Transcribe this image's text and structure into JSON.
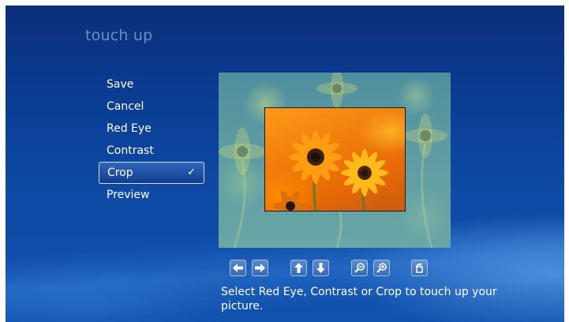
{
  "page": {
    "title": "touch up",
    "hint": "Select Red Eye, Contrast or Crop to touch up your picture."
  },
  "menu": {
    "items": [
      {
        "label": "Save",
        "active": false
      },
      {
        "label": "Cancel",
        "active": false
      },
      {
        "label": "Red Eye",
        "active": false
      },
      {
        "label": "Contrast",
        "active": false
      },
      {
        "label": "Crop",
        "active": true,
        "check": "✓"
      },
      {
        "label": "Preview",
        "active": false
      }
    ]
  },
  "toolbar": {
    "buttons": [
      {
        "name": "pan-left-button",
        "icon": "arrow-left-icon"
      },
      {
        "name": "pan-right-button",
        "icon": "arrow-right-icon"
      },
      {
        "name": "pan-up-button",
        "icon": "arrow-up-icon"
      },
      {
        "name": "pan-down-button",
        "icon": "arrow-down-icon"
      },
      {
        "name": "zoom-out-button",
        "icon": "zoom-out-icon"
      },
      {
        "name": "zoom-in-button",
        "icon": "zoom-in-icon"
      },
      {
        "name": "rotate-button",
        "icon": "rotate-icon"
      }
    ]
  },
  "colors": {
    "background": "#0a3d93",
    "title": "#6b8fc7",
    "text": "#ffffff",
    "selection_border": "#cfe0f5"
  }
}
